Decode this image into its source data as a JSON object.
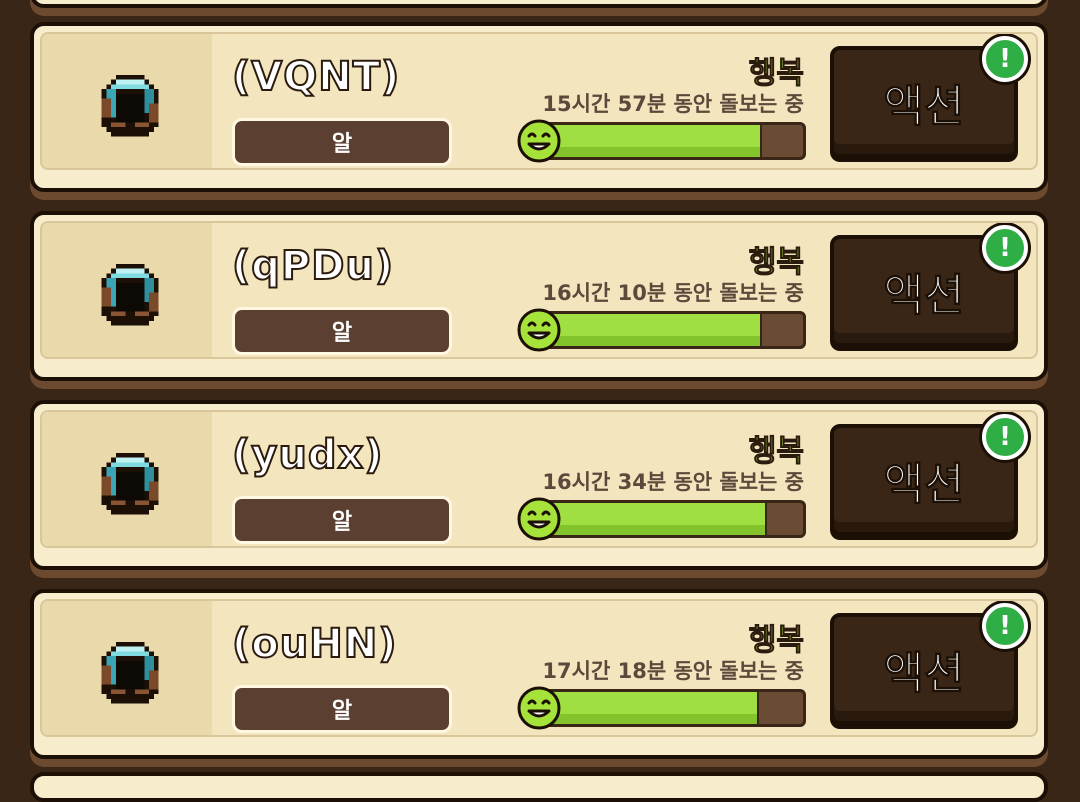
{
  "pets": [
    {
      "name": "(VQNT)",
      "stage": "알",
      "mood": "행복",
      "care_time": "15시간 57분 동안 돌보는 중",
      "happiness_fill": 0.84,
      "action_label": "액션",
      "alert": "!"
    },
    {
      "name": "(qPDu)",
      "stage": "알",
      "mood": "행복",
      "care_time": "16시간 10분 동안 돌보는 중",
      "happiness_fill": 0.84,
      "action_label": "액션",
      "alert": "!"
    },
    {
      "name": "(yudx)",
      "stage": "알",
      "mood": "행복",
      "care_time": "16시간 34분 동안 돌보는 중",
      "happiness_fill": 0.86,
      "action_label": "액션",
      "alert": "!"
    },
    {
      "name": "(ouHN)",
      "stage": "알",
      "mood": "행복",
      "care_time": "17시간 18분 동안 돌보는 중",
      "happiness_fill": 0.83,
      "action_label": "액션",
      "alert": "!"
    }
  ],
  "colors": {
    "mood_green": "#a6e33a",
    "bar_fill": "#9fdf42",
    "alert_green": "#2fae45",
    "panel_cream": "#f7eccb",
    "dark_brown": "#3a2617"
  },
  "icons": {
    "egg": "egg-icon",
    "smile": "smile-face-icon",
    "alert": "exclamation-icon"
  }
}
